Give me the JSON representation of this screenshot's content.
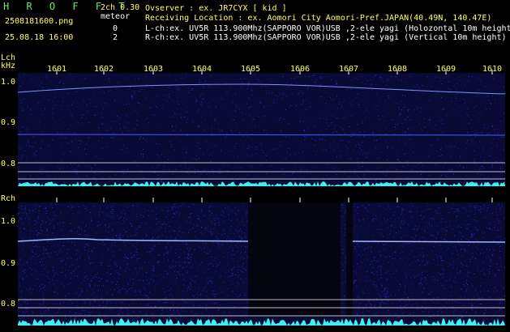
{
  "header": {
    "app_title": "H R O F F T",
    "channel_info": "2ch 0.30",
    "meteor_label": "meteor",
    "filename": "2508181600.png",
    "datetime": "25.08.18 16:00",
    "l_count": "0",
    "r_count": "2",
    "observer_line": "Ovserver            : ex. JR7CYX [ kid ]",
    "location_line": "Receiving Location : ex. Aomori City Aomori-Pref.JAPAN(40.49N, 140.47E)",
    "lch_line": "L-ch:ex. UV5R 113.900Mhz(SAPPORO VOR)USB ,2-ele yagi (Holozontal 10m height",
    "rch_line": "R-ch:ex. UV5R 113.900Mhz(SAPPORO VOR)USB ,2-ele yagi (Vertical 10m height)"
  },
  "axis": {
    "lch_label": "Lch",
    "khz_label": "kHz",
    "rch_label": "Rch",
    "x_ticks": [
      "1601",
      "1602",
      "1603",
      "1604",
      "1605",
      "1606",
      "1607",
      "1608",
      "1609",
      "1610"
    ],
    "y_ticks": [
      "1.0",
      "0.9",
      "0.8"
    ]
  },
  "colors": {
    "spectrum_bg": "#0a0a36",
    "noise": "#2a3aff",
    "trace": "#9fb6ff",
    "baseline": "#3ff0f0",
    "gap": "#050512"
  }
}
